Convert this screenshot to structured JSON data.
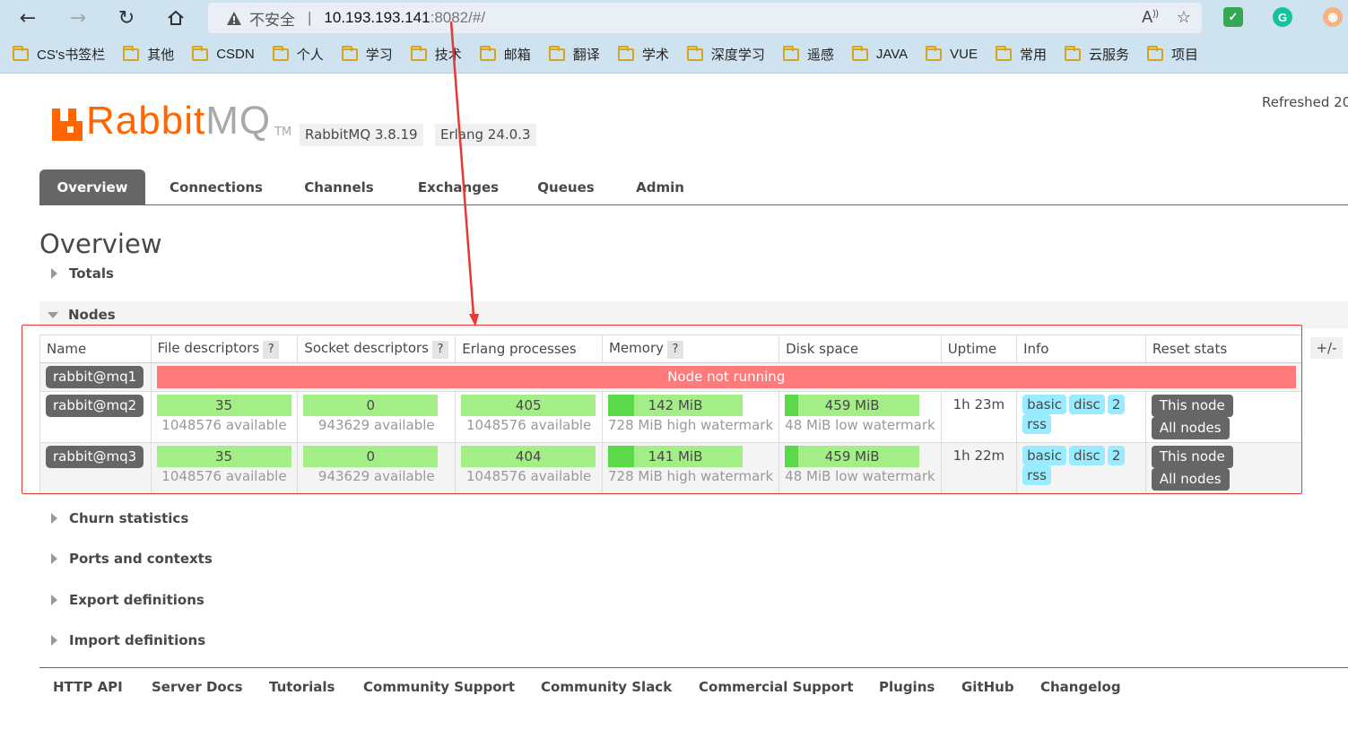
{
  "browser": {
    "insecure_label": "不安全",
    "url_host": "10.193.193.141",
    "url_rest": ":8082/#/",
    "extension_g": "G",
    "bookmarks": [
      "CS's书签栏",
      "其他",
      "CSDN",
      "个人",
      "学习",
      "技术",
      "邮箱",
      "翻译",
      "学术",
      "深度学习",
      "遥感",
      "JAVA",
      "VUE",
      "常用",
      "云服务",
      "项目"
    ]
  },
  "header": {
    "refreshed": "Refreshed 20",
    "logo_rabbit": "Rabbit",
    "logo_mq": "MQ",
    "logo_tm": "TM",
    "rabbitmq_version": "RabbitMQ 3.8.19",
    "erlang_version": "Erlang 24.0.3"
  },
  "tabs": [
    "Overview",
    "Connections",
    "Channels",
    "Exchanges",
    "Queues",
    "Admin"
  ],
  "page_title": "Overview",
  "sections": {
    "totals": "Totals",
    "nodes": "Nodes",
    "churn": "Churn statistics",
    "ports": "Ports and contexts",
    "export": "Export definitions",
    "import": "Import definitions"
  },
  "table": {
    "headers": {
      "name": "Name",
      "file_descriptors": "File descriptors",
      "socket_descriptors": "Socket descriptors",
      "erlang_processes": "Erlang processes",
      "memory": "Memory",
      "disk_space": "Disk space",
      "uptime": "Uptime",
      "info": "Info",
      "reset_stats": "Reset stats",
      "help": "?"
    },
    "plus_minus": "+/-",
    "node1": {
      "name": "rabbit@mq1",
      "status": "Node not running"
    },
    "node2": {
      "name": "rabbit@mq2",
      "fd": "35",
      "fd_avail": "1048576 available",
      "sd": "0",
      "sd_avail": "943629 available",
      "ep": "405",
      "ep_avail": "1048576 available",
      "mem": "142 MiB",
      "mem_sub": "728 MiB high watermark",
      "mem_fill": 0.195,
      "disk": "459 MiB",
      "disk_sub": "48 MiB low watermark",
      "disk_fill": 0.1,
      "uptime": "1h 23m",
      "info": [
        "basic",
        "disc",
        "2",
        "rss"
      ],
      "reset_this": "This node",
      "reset_all": "All nodes"
    },
    "node3": {
      "name": "rabbit@mq3",
      "fd": "35",
      "fd_avail": "1048576 available",
      "sd": "0",
      "sd_avail": "943629 available",
      "ep": "404",
      "ep_avail": "1048576 available",
      "mem": "141 MiB",
      "mem_sub": "728 MiB high watermark",
      "mem_fill": 0.194,
      "disk": "459 MiB",
      "disk_sub": "48 MiB low watermark",
      "disk_fill": 0.1,
      "uptime": "1h 22m",
      "info": [
        "basic",
        "disc",
        "2",
        "rss"
      ],
      "reset_this": "This node",
      "reset_all": "All nodes"
    }
  },
  "footer": [
    "HTTP API",
    "Server Docs",
    "Tutorials",
    "Community Support",
    "Community Slack",
    "Commercial Support",
    "Plugins",
    "GitHub",
    "Changelog"
  ],
  "colors": {
    "brand_orange": "#ff6600",
    "bar_light_green": "#a3ee86",
    "bar_dark_green": "#5cd94a",
    "not_running_red": "#ff7a7a",
    "info_badge_blue": "#99ebff",
    "annotation_red": "#e53935"
  }
}
